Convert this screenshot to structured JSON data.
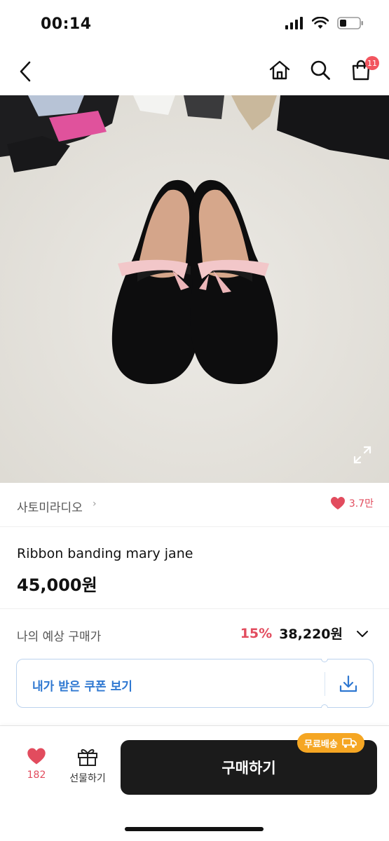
{
  "status": {
    "time": "00:14"
  },
  "nav": {
    "cart_count": "11"
  },
  "store": {
    "name": "사토미라디오",
    "chevron": "›",
    "like_count": "3.7만"
  },
  "product": {
    "name": "Ribbon banding mary jane",
    "price": "45,000원"
  },
  "expected": {
    "label": "나의 예상 구매가",
    "discount": "15%",
    "price": "38,220원"
  },
  "coupon": {
    "label": "내가 받은 쿠폰 보기"
  },
  "bottom": {
    "wish_count": "182",
    "gift_label": "선물하기",
    "buy_label": "구매하기",
    "free_shipping": "무료배송"
  },
  "colors": {
    "accent_red": "#e24c5e",
    "coupon_blue": "#2f78d1",
    "badge_orange": "#f5a623",
    "buy_black": "#1b1b1b"
  },
  "icons": [
    "back-icon",
    "home-icon",
    "search-icon",
    "cart-icon",
    "expand-icon",
    "heart-icon",
    "chevron-down-icon",
    "download-icon",
    "gift-icon",
    "truck-icon"
  ]
}
